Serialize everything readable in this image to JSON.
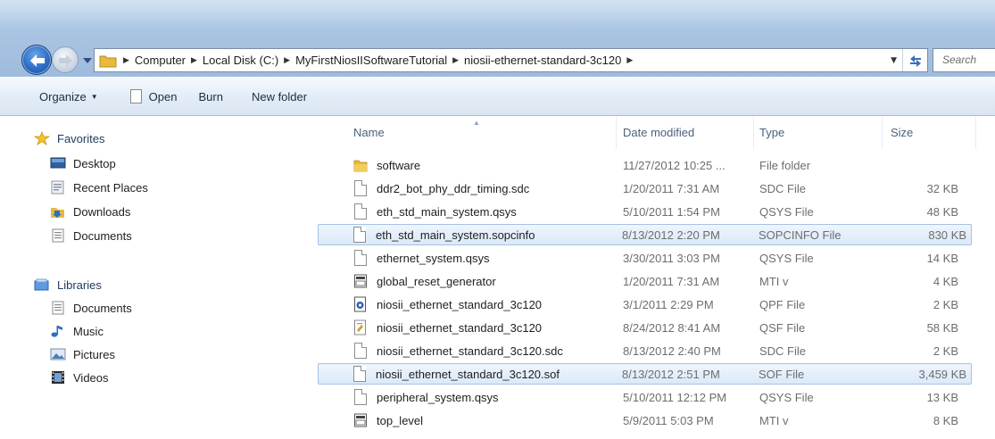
{
  "window": {
    "address": {
      "crumbs": [
        "Computer",
        "Local Disk (C:)",
        "MyFirstNiosIISoftwareTutorial",
        "niosii-ethernet-standard-3c120"
      ]
    },
    "search_placeholder": "Search"
  },
  "toolbar": {
    "organize": "Organize",
    "open": "Open",
    "burn": "Burn",
    "new_folder": "New folder"
  },
  "navpane": {
    "favorites": {
      "label": "Favorites",
      "items": [
        "Desktop",
        "Recent Places",
        "Downloads",
        "Documents"
      ]
    },
    "libraries": {
      "label": "Libraries",
      "items": [
        "Documents",
        "Music",
        "Pictures",
        "Videos"
      ]
    }
  },
  "columns": {
    "name": "Name",
    "date": "Date modified",
    "type": "Type",
    "size": "Size"
  },
  "files": [
    {
      "name": "software",
      "date": "11/27/2012 10:25 ...",
      "type": "File folder",
      "size": "",
      "icon": "folder-icon",
      "selected": false
    },
    {
      "name": "ddr2_bot_phy_ddr_timing.sdc",
      "date": "1/20/2011 7:31 AM",
      "type": "SDC File",
      "size": "32 KB",
      "icon": "file-icon",
      "selected": false
    },
    {
      "name": "eth_std_main_system.qsys",
      "date": "5/10/2011 1:54 PM",
      "type": "QSYS File",
      "size": "48 KB",
      "icon": "file-icon",
      "selected": false
    },
    {
      "name": "eth_std_main_system.sopcinfo",
      "date": "8/13/2012 2:20 PM",
      "type": "SOPCINFO File",
      "size": "830 KB",
      "icon": "file-icon",
      "selected": true
    },
    {
      "name": "ethernet_system.qsys",
      "date": "3/30/2011 3:03 PM",
      "type": "QSYS File",
      "size": "14 KB",
      "icon": "file-icon",
      "selected": false
    },
    {
      "name": "global_reset_generator",
      "date": "1/20/2011 7:31 AM",
      "type": "MTI v",
      "size": "4 KB",
      "icon": "mti-file-icon",
      "selected": false
    },
    {
      "name": "niosii_ethernet_standard_3c120",
      "date": "3/1/2011 2:29 PM",
      "type": "QPF File",
      "size": "2 KB",
      "icon": "qpf-file-icon",
      "selected": false
    },
    {
      "name": "niosii_ethernet_standard_3c120",
      "date": "8/24/2012 8:41 AM",
      "type": "QSF File",
      "size": "58 KB",
      "icon": "qsf-file-icon",
      "selected": false
    },
    {
      "name": "niosii_ethernet_standard_3c120.sdc",
      "date": "8/13/2012 2:40 PM",
      "type": "SDC File",
      "size": "2 KB",
      "icon": "file-icon",
      "selected": false
    },
    {
      "name": "niosii_ethernet_standard_3c120.sof",
      "date": "8/13/2012 2:51 PM",
      "type": "SOF File",
      "size": "3,459 KB",
      "icon": "file-icon",
      "selected": true
    },
    {
      "name": "peripheral_system.qsys",
      "date": "5/10/2011 12:12 PM",
      "type": "QSYS File",
      "size": "13 KB",
      "icon": "file-icon",
      "selected": false
    },
    {
      "name": "top_level",
      "date": "5/9/2011 5:03 PM",
      "type": "MTI v",
      "size": "8 KB",
      "icon": "mti-file-icon",
      "selected": false
    }
  ],
  "colors": {
    "selection_fill": "#dbe9f9",
    "selection_border": "#a6c2e4",
    "header_text": "#4c607a",
    "folder_yellow": "#e8b93a"
  }
}
